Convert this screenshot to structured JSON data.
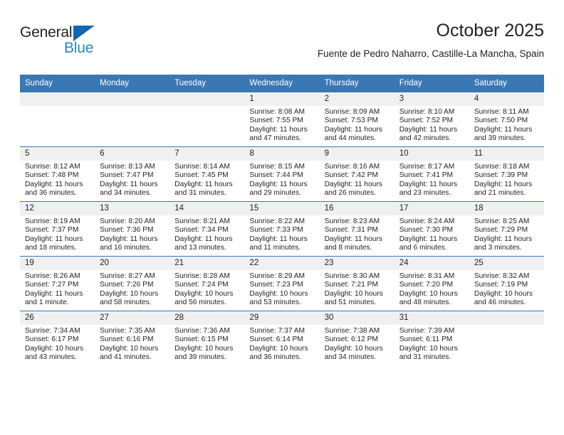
{
  "logo": {
    "word_top": "General",
    "word_bottom": "Blue",
    "triangle_color": "#1268b3",
    "blue_color": "#2585c9"
  },
  "header": {
    "title": "October 2025",
    "subtitle": "Fuente de Pedro Naharro, Castille-La Mancha, Spain"
  },
  "theme": {
    "header_blue": "#3a78b5",
    "daynum_background": "#f0f0f0",
    "text_color": "#231f20"
  },
  "calendar": {
    "weekday_headers": [
      "Sunday",
      "Monday",
      "Tuesday",
      "Wednesday",
      "Thursday",
      "Friday",
      "Saturday"
    ],
    "weeks": [
      [
        {
          "day": "",
          "empty": true
        },
        {
          "day": "",
          "empty": true
        },
        {
          "day": "",
          "empty": true
        },
        {
          "day": "1",
          "sunrise": "Sunrise: 8:08 AM",
          "sunset": "Sunset: 7:55 PM",
          "daylight_1": "Daylight: 11 hours",
          "daylight_2": "and 47 minutes."
        },
        {
          "day": "2",
          "sunrise": "Sunrise: 8:09 AM",
          "sunset": "Sunset: 7:53 PM",
          "daylight_1": "Daylight: 11 hours",
          "daylight_2": "and 44 minutes."
        },
        {
          "day": "3",
          "sunrise": "Sunrise: 8:10 AM",
          "sunset": "Sunset: 7:52 PM",
          "daylight_1": "Daylight: 11 hours",
          "daylight_2": "and 42 minutes."
        },
        {
          "day": "4",
          "sunrise": "Sunrise: 8:11 AM",
          "sunset": "Sunset: 7:50 PM",
          "daylight_1": "Daylight: 11 hours",
          "daylight_2": "and 39 minutes."
        }
      ],
      [
        {
          "day": "5",
          "sunrise": "Sunrise: 8:12 AM",
          "sunset": "Sunset: 7:48 PM",
          "daylight_1": "Daylight: 11 hours",
          "daylight_2": "and 36 minutes."
        },
        {
          "day": "6",
          "sunrise": "Sunrise: 8:13 AM",
          "sunset": "Sunset: 7:47 PM",
          "daylight_1": "Daylight: 11 hours",
          "daylight_2": "and 34 minutes."
        },
        {
          "day": "7",
          "sunrise": "Sunrise: 8:14 AM",
          "sunset": "Sunset: 7:45 PM",
          "daylight_1": "Daylight: 11 hours",
          "daylight_2": "and 31 minutes."
        },
        {
          "day": "8",
          "sunrise": "Sunrise: 8:15 AM",
          "sunset": "Sunset: 7:44 PM",
          "daylight_1": "Daylight: 11 hours",
          "daylight_2": "and 29 minutes."
        },
        {
          "day": "9",
          "sunrise": "Sunrise: 8:16 AM",
          "sunset": "Sunset: 7:42 PM",
          "daylight_1": "Daylight: 11 hours",
          "daylight_2": "and 26 minutes."
        },
        {
          "day": "10",
          "sunrise": "Sunrise: 8:17 AM",
          "sunset": "Sunset: 7:41 PM",
          "daylight_1": "Daylight: 11 hours",
          "daylight_2": "and 23 minutes."
        },
        {
          "day": "11",
          "sunrise": "Sunrise: 8:18 AM",
          "sunset": "Sunset: 7:39 PM",
          "daylight_1": "Daylight: 11 hours",
          "daylight_2": "and 21 minutes."
        }
      ],
      [
        {
          "day": "12",
          "sunrise": "Sunrise: 8:19 AM",
          "sunset": "Sunset: 7:37 PM",
          "daylight_1": "Daylight: 11 hours",
          "daylight_2": "and 18 minutes."
        },
        {
          "day": "13",
          "sunrise": "Sunrise: 8:20 AM",
          "sunset": "Sunset: 7:36 PM",
          "daylight_1": "Daylight: 11 hours",
          "daylight_2": "and 16 minutes."
        },
        {
          "day": "14",
          "sunrise": "Sunrise: 8:21 AM",
          "sunset": "Sunset: 7:34 PM",
          "daylight_1": "Daylight: 11 hours",
          "daylight_2": "and 13 minutes."
        },
        {
          "day": "15",
          "sunrise": "Sunrise: 8:22 AM",
          "sunset": "Sunset: 7:33 PM",
          "daylight_1": "Daylight: 11 hours",
          "daylight_2": "and 11 minutes."
        },
        {
          "day": "16",
          "sunrise": "Sunrise: 8:23 AM",
          "sunset": "Sunset: 7:31 PM",
          "daylight_1": "Daylight: 11 hours",
          "daylight_2": "and 8 minutes."
        },
        {
          "day": "17",
          "sunrise": "Sunrise: 8:24 AM",
          "sunset": "Sunset: 7:30 PM",
          "daylight_1": "Daylight: 11 hours",
          "daylight_2": "and 6 minutes."
        },
        {
          "day": "18",
          "sunrise": "Sunrise: 8:25 AM",
          "sunset": "Sunset: 7:29 PM",
          "daylight_1": "Daylight: 11 hours",
          "daylight_2": "and 3 minutes."
        }
      ],
      [
        {
          "day": "19",
          "sunrise": "Sunrise: 8:26 AM",
          "sunset": "Sunset: 7:27 PM",
          "daylight_1": "Daylight: 11 hours",
          "daylight_2": "and 1 minute."
        },
        {
          "day": "20",
          "sunrise": "Sunrise: 8:27 AM",
          "sunset": "Sunset: 7:26 PM",
          "daylight_1": "Daylight: 10 hours",
          "daylight_2": "and 58 minutes."
        },
        {
          "day": "21",
          "sunrise": "Sunrise: 8:28 AM",
          "sunset": "Sunset: 7:24 PM",
          "daylight_1": "Daylight: 10 hours",
          "daylight_2": "and 56 minutes."
        },
        {
          "day": "22",
          "sunrise": "Sunrise: 8:29 AM",
          "sunset": "Sunset: 7:23 PM",
          "daylight_1": "Daylight: 10 hours",
          "daylight_2": "and 53 minutes."
        },
        {
          "day": "23",
          "sunrise": "Sunrise: 8:30 AM",
          "sunset": "Sunset: 7:21 PM",
          "daylight_1": "Daylight: 10 hours",
          "daylight_2": "and 51 minutes."
        },
        {
          "day": "24",
          "sunrise": "Sunrise: 8:31 AM",
          "sunset": "Sunset: 7:20 PM",
          "daylight_1": "Daylight: 10 hours",
          "daylight_2": "and 48 minutes."
        },
        {
          "day": "25",
          "sunrise": "Sunrise: 8:32 AM",
          "sunset": "Sunset: 7:19 PM",
          "daylight_1": "Daylight: 10 hours",
          "daylight_2": "and 46 minutes."
        }
      ],
      [
        {
          "day": "26",
          "sunrise": "Sunrise: 7:34 AM",
          "sunset": "Sunset: 6:17 PM",
          "daylight_1": "Daylight: 10 hours",
          "daylight_2": "and 43 minutes."
        },
        {
          "day": "27",
          "sunrise": "Sunrise: 7:35 AM",
          "sunset": "Sunset: 6:16 PM",
          "daylight_1": "Daylight: 10 hours",
          "daylight_2": "and 41 minutes."
        },
        {
          "day": "28",
          "sunrise": "Sunrise: 7:36 AM",
          "sunset": "Sunset: 6:15 PM",
          "daylight_1": "Daylight: 10 hours",
          "daylight_2": "and 39 minutes."
        },
        {
          "day": "29",
          "sunrise": "Sunrise: 7:37 AM",
          "sunset": "Sunset: 6:14 PM",
          "daylight_1": "Daylight: 10 hours",
          "daylight_2": "and 36 minutes."
        },
        {
          "day": "30",
          "sunrise": "Sunrise: 7:38 AM",
          "sunset": "Sunset: 6:12 PM",
          "daylight_1": "Daylight: 10 hours",
          "daylight_2": "and 34 minutes."
        },
        {
          "day": "31",
          "sunrise": "Sunrise: 7:39 AM",
          "sunset": "Sunset: 6:11 PM",
          "daylight_1": "Daylight: 10 hours",
          "daylight_2": "and 31 minutes."
        },
        {
          "day": "",
          "empty": true
        }
      ]
    ]
  }
}
